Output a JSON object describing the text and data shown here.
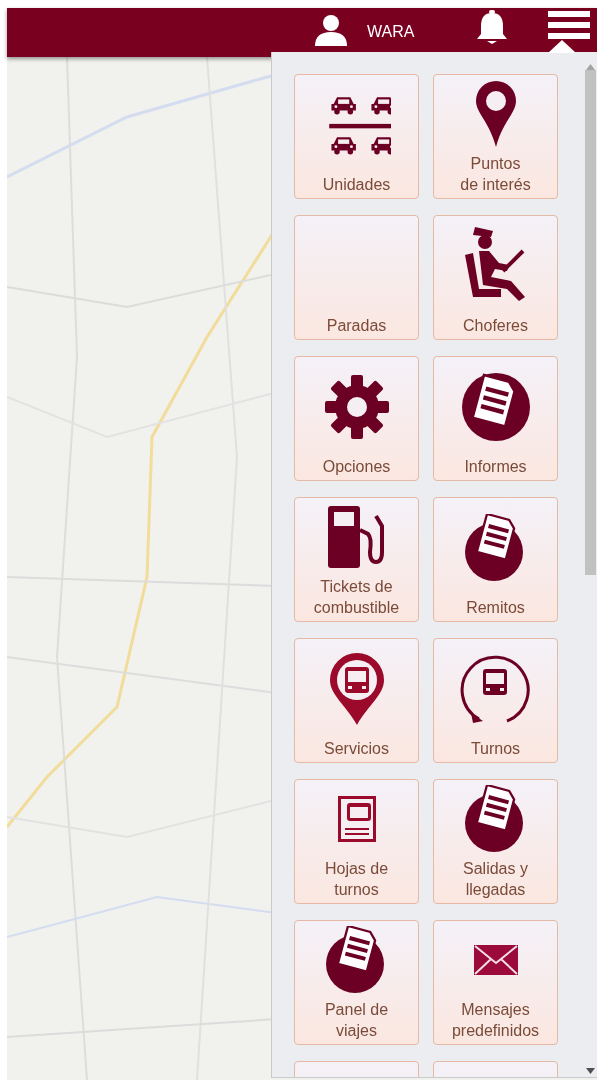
{
  "header": {
    "user_name": "WARA"
  },
  "menu": {
    "rows": [
      {
        "tiles": [
          {
            "kind": "tile",
            "label": "Unidades"
          },
          {
            "kind": "tile",
            "label": "Puntos\nde interés"
          }
        ]
      },
      {
        "tiles": [
          {
            "kind": "tile",
            "label": "Paradas"
          },
          {
            "kind": "tile",
            "label": "Choferes"
          }
        ]
      },
      {
        "tiles": [
          {
            "kind": "tile",
            "label": "Opciones"
          },
          {
            "kind": "tile",
            "label": "Informes"
          }
        ]
      },
      {
        "tiles": [
          {
            "kind": "tile",
            "label": "Tickets de\ncombustible"
          },
          {
            "kind": "tile",
            "label": "Remitos"
          }
        ]
      },
      {
        "tiles": [
          {
            "kind": "tile",
            "label": "Servicios"
          },
          {
            "kind": "tile",
            "label": "Turnos"
          }
        ]
      },
      {
        "tiles": [
          {
            "kind": "tile",
            "label": "Hojas de\nturnos"
          },
          {
            "kind": "tile",
            "label": "Salidas y\nllegadas"
          }
        ]
      },
      {
        "tiles": [
          {
            "kind": "tile",
            "label": "Panel de\nviajes"
          },
          {
            "kind": "tile",
            "label": "Mensajes\npredefinidos"
          }
        ]
      },
      {
        "tiles": [
          {
            "kind": "cut"
          },
          {
            "kind": "cut"
          }
        ]
      }
    ]
  }
}
